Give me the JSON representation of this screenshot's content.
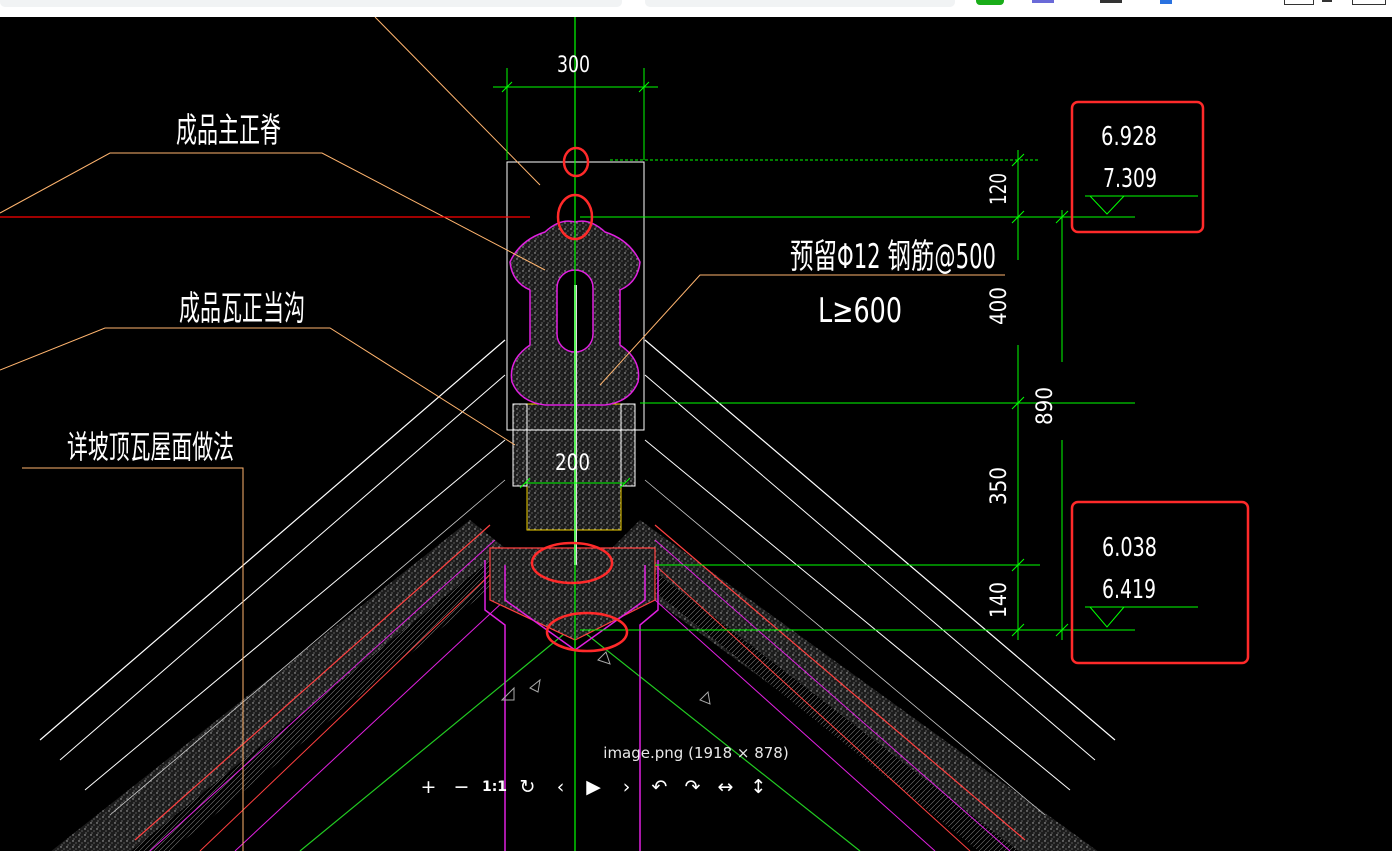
{
  "drawing": {
    "dims": {
      "d300": "300",
      "d120": "120",
      "d400": "400",
      "d890": "890",
      "d350": "350",
      "d200": "200",
      "d140": "140"
    },
    "labels": {
      "main_ridge": "成品主正脊",
      "tile_gutter": "成品瓦正当沟",
      "roof_method": "详坡顶瓦屋面做法",
      "rebar_line1": "预留Φ12 钢筋@500",
      "rebar_line2": "L≥600"
    },
    "elevations": {
      "top_box": [
        "6.928",
        "7.309"
      ],
      "bottom_box": [
        "6.038",
        "6.419"
      ]
    }
  },
  "viewer": {
    "caption": "image.png (1918 × 878)",
    "controls": [
      {
        "name": "zoom-in-button",
        "icon": "+"
      },
      {
        "name": "zoom-out-button",
        "icon": "−"
      },
      {
        "name": "actual-size-button",
        "icon": "1:1"
      },
      {
        "name": "reset-button",
        "icon": "↻"
      },
      {
        "name": "prev-button",
        "icon": "‹"
      },
      {
        "name": "play-button",
        "icon": "▶"
      },
      {
        "name": "next-button",
        "icon": "›"
      },
      {
        "name": "rotate-left-button",
        "icon": "↶"
      },
      {
        "name": "rotate-right-button",
        "icon": "↷"
      },
      {
        "name": "flip-horizontal-button",
        "icon": "↔"
      },
      {
        "name": "flip-vertical-button",
        "icon": "↕"
      }
    ]
  },
  "colors": {
    "background": "#000000",
    "dimension": "#00ff00",
    "leader": "#ffb46e",
    "outline": "#ffffff",
    "magenta": "#e020e0",
    "highlight": "#ff2a2a",
    "ridge_red": "#ff0000"
  }
}
